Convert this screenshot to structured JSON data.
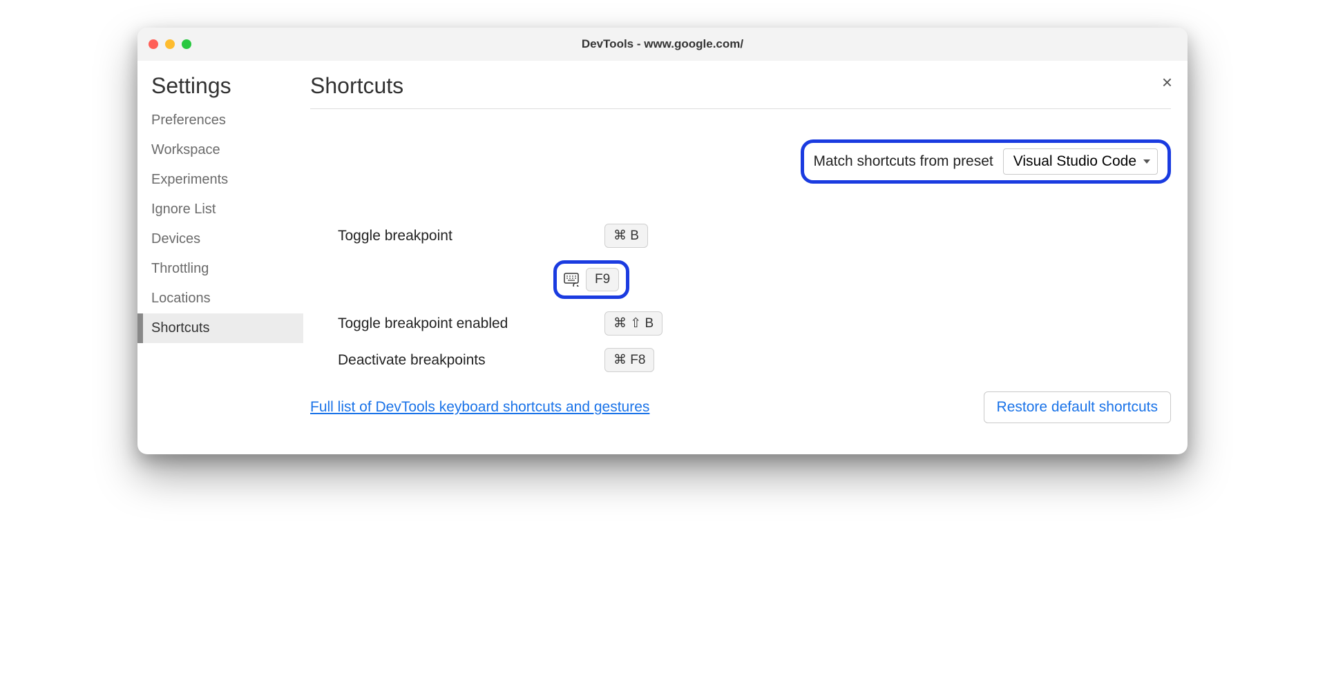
{
  "titlebar": {
    "title": "DevTools - www.google.com/"
  },
  "sidebar": {
    "heading": "Settings",
    "items": [
      {
        "label": "Preferences",
        "active": false
      },
      {
        "label": "Workspace",
        "active": false
      },
      {
        "label": "Experiments",
        "active": false
      },
      {
        "label": "Ignore List",
        "active": false
      },
      {
        "label": "Devices",
        "active": false
      },
      {
        "label": "Throttling",
        "active": false
      },
      {
        "label": "Locations",
        "active": false
      },
      {
        "label": "Shortcuts",
        "active": true
      }
    ]
  },
  "main": {
    "heading": "Shortcuts",
    "preset_label": "Match shortcuts from preset",
    "preset_value": "Visual Studio Code",
    "shortcuts": [
      {
        "label": "Toggle breakpoint",
        "keys": "⌘ B",
        "has_keyboard_icon": false,
        "highlighted": false
      },
      {
        "label": "",
        "keys": "F9",
        "has_keyboard_icon": true,
        "highlighted": true
      },
      {
        "label": "Toggle breakpoint enabled",
        "keys": "⌘ ⇧ B",
        "has_keyboard_icon": false,
        "highlighted": false
      },
      {
        "label": "Deactivate breakpoints",
        "keys": "⌘ F8",
        "has_keyboard_icon": false,
        "highlighted": false
      }
    ],
    "link_text": "Full list of DevTools keyboard shortcuts and gestures",
    "restore_button": "Restore default shortcuts"
  },
  "highlight_color": "#1a3be0",
  "link_color": "#1a73e8"
}
